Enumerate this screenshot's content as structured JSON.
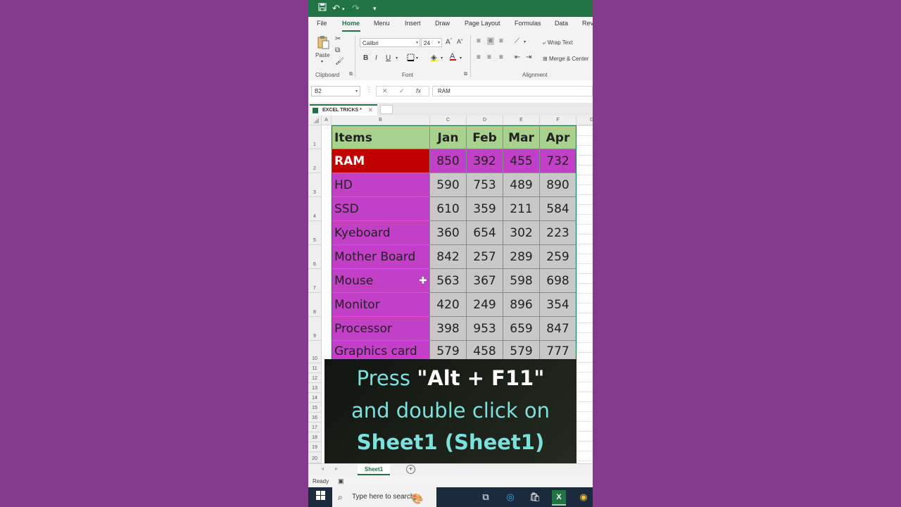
{
  "titlebar": {
    "save_icon": "save-icon",
    "undo_icon": "undo-icon",
    "redo_icon": "redo-icon"
  },
  "ribbon_tabs": [
    "File",
    "Home",
    "Menu",
    "Insert",
    "Draw",
    "Page Layout",
    "Formulas",
    "Data",
    "Rev"
  ],
  "ribbon": {
    "paste_label": "Paste",
    "font_name": "Calibri",
    "font_size": "24",
    "bold": "B",
    "italic": "I",
    "underline": "U",
    "wrap_text": "Wrap Text",
    "merge_center": "Merge & Center",
    "groups": {
      "clipboard": "Clipboard",
      "font": "Font",
      "alignment": "Alignment"
    }
  },
  "formula_bar": {
    "name_box": "B2",
    "fx": "fx",
    "value": "RAM"
  },
  "workbook_tab": {
    "label": "EXCEL TRICKS *"
  },
  "columns": [
    "A",
    "B",
    "C",
    "D",
    "E",
    "F",
    "G"
  ],
  "rows": [
    "1",
    "2",
    "3",
    "4",
    "5",
    "6",
    "7",
    "8",
    "9",
    "10",
    "11",
    "12",
    "13",
    "14",
    "15",
    "16",
    "17",
    "18",
    "19",
    "20"
  ],
  "table": {
    "headers": [
      "Items",
      "Jan",
      "Feb",
      "Mar",
      "Apr"
    ],
    "rows": [
      [
        "RAM",
        "850",
        "392",
        "455",
        "732"
      ],
      [
        "HD",
        "590",
        "753",
        "489",
        "890"
      ],
      [
        "SSD",
        "610",
        "359",
        "211",
        "584"
      ],
      [
        "Kyeboard",
        "360",
        "654",
        "302",
        "223"
      ],
      [
        "Mother Board",
        "842",
        "257",
        "289",
        "259"
      ],
      [
        "Mouse",
        "563",
        "367",
        "598",
        "698"
      ],
      [
        "Monitor",
        "420",
        "249",
        "896",
        "354"
      ],
      [
        "Processor",
        "398",
        "953",
        "659",
        "847"
      ],
      [
        "Graphics card",
        "579",
        "458",
        "579",
        "777"
      ]
    ]
  },
  "colors": {
    "excel_green": "#217346",
    "header_fill": "#a9d18e",
    "item_fill": "#c140c6",
    "selected_fill": "#c00000",
    "value_fill": "#c8c8c8",
    "highlight_row_fill": "#c140c6",
    "caption_text": "#7ee0dc",
    "page_bg": "#853b8c"
  },
  "overlay": {
    "line1_pre": "Press ",
    "line1_bold": "\"Alt + F11\"",
    "line2": "and double click on",
    "line3": "Sheet1 (Sheet1)"
  },
  "sheet_tab": "Sheet1",
  "status": "Ready",
  "taskbar": {
    "search_placeholder": "Type here to search"
  }
}
